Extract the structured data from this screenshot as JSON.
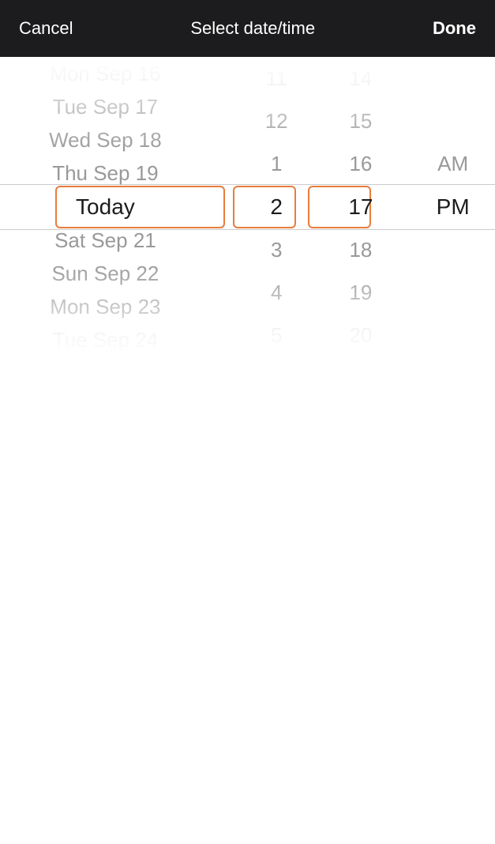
{
  "header": {
    "cancel_label": "Cancel",
    "title": "Select date/time",
    "done_label": "Done"
  },
  "picker": {
    "dates": [
      {
        "label": "Mon Sep 16",
        "state": "far"
      },
      {
        "label": "Tue Sep 17",
        "state": "near"
      },
      {
        "label": "Wed Sep 18",
        "state": "near"
      },
      {
        "label": "Thu Sep 19",
        "state": "near"
      },
      {
        "label": "Today",
        "state": "selected"
      },
      {
        "label": "Sat Sep 21",
        "state": "near"
      },
      {
        "label": "Sun Sep 22",
        "state": "near"
      },
      {
        "label": "Mon Sep 23",
        "state": "near"
      },
      {
        "label": "Tue Sep 24",
        "state": "far"
      }
    ],
    "hours": [
      {
        "label": "11",
        "state": "far"
      },
      {
        "label": "12",
        "state": "near"
      },
      {
        "label": "1",
        "state": "near"
      },
      {
        "label": "2",
        "state": "selected"
      },
      {
        "label": "3",
        "state": "near"
      },
      {
        "label": "4",
        "state": "near"
      },
      {
        "label": "5",
        "state": "far"
      }
    ],
    "minutes": [
      {
        "label": "14",
        "state": "far"
      },
      {
        "label": "15",
        "state": "near"
      },
      {
        "label": "16",
        "state": "near"
      },
      {
        "label": "17",
        "state": "selected"
      },
      {
        "label": "18",
        "state": "near"
      },
      {
        "label": "19",
        "state": "near"
      },
      {
        "label": "20",
        "state": "far"
      }
    ],
    "ampm": [
      {
        "label": "AM",
        "state": "near"
      },
      {
        "label": "PM",
        "state": "selected"
      }
    ]
  },
  "colors": {
    "header_bg": "#1c1c1e",
    "selected_border": "#e87d3c",
    "selected_text": "#1c1c1e",
    "near_text": "#999999",
    "far_text": "#d8d8d8"
  }
}
